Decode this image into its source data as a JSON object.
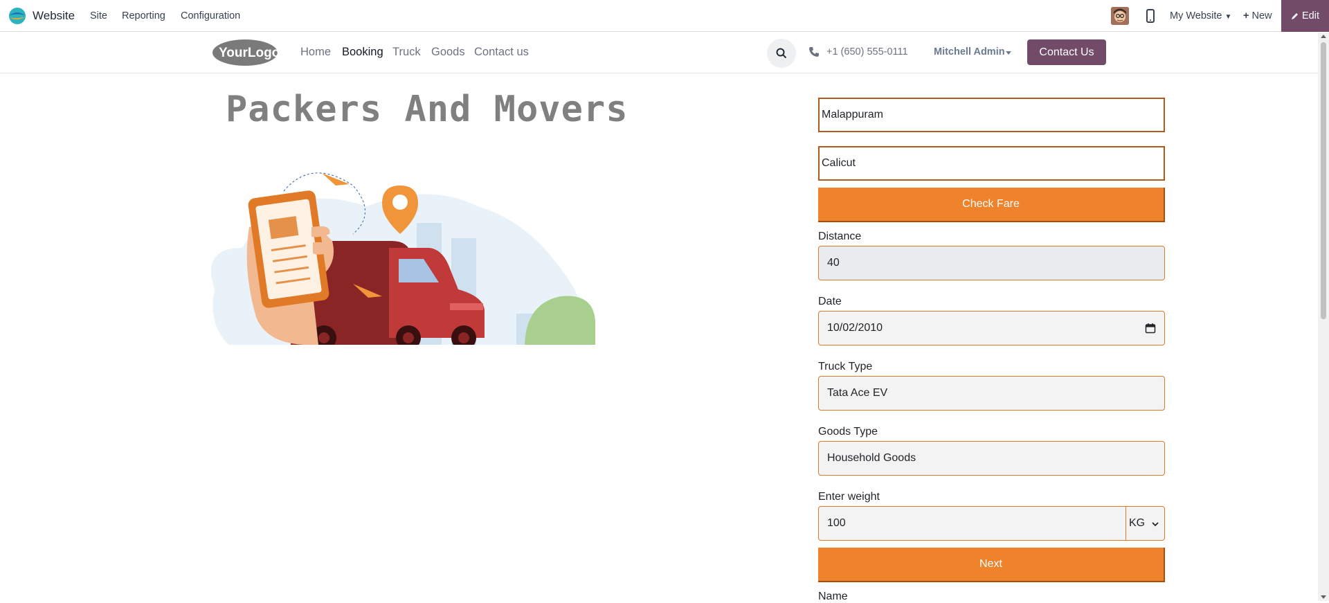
{
  "admin_bar": {
    "app_name": "Website",
    "menu": [
      "Site",
      "Reporting",
      "Configuration"
    ],
    "website_selector": "My Website",
    "new_label": "New",
    "edit_label": "Edit",
    "edit_color": "#714b67"
  },
  "site_header": {
    "logo_text": "YourLogo",
    "nav": [
      {
        "label": "Home",
        "active": false
      },
      {
        "label": "Booking",
        "active": true
      },
      {
        "label": "Truck",
        "active": false
      },
      {
        "label": "Goods",
        "active": false
      },
      {
        "label": "Contact us",
        "active": false
      }
    ],
    "phone": "+1 (650) 555-0111",
    "user": "Mitchell Admin",
    "contact_button": "Contact Us"
  },
  "main": {
    "title": "Packers And Movers"
  },
  "form": {
    "from_location": "Malappuram",
    "to_location": "Calicut",
    "check_fare_label": "Check Fare",
    "distance_label": "Distance",
    "distance_value": "40",
    "date_label": "Date",
    "date_value": "10/02/2010",
    "truck_type_label": "Truck Type",
    "truck_type_value": "Tata Ace EV",
    "goods_type_label": "Goods Type",
    "goods_type_value": "Household Goods",
    "weight_label": "Enter weight",
    "weight_value": "100",
    "weight_unit": "KG",
    "next_label": "Next",
    "name_label": "Name",
    "accent_color": "#ee832c"
  }
}
